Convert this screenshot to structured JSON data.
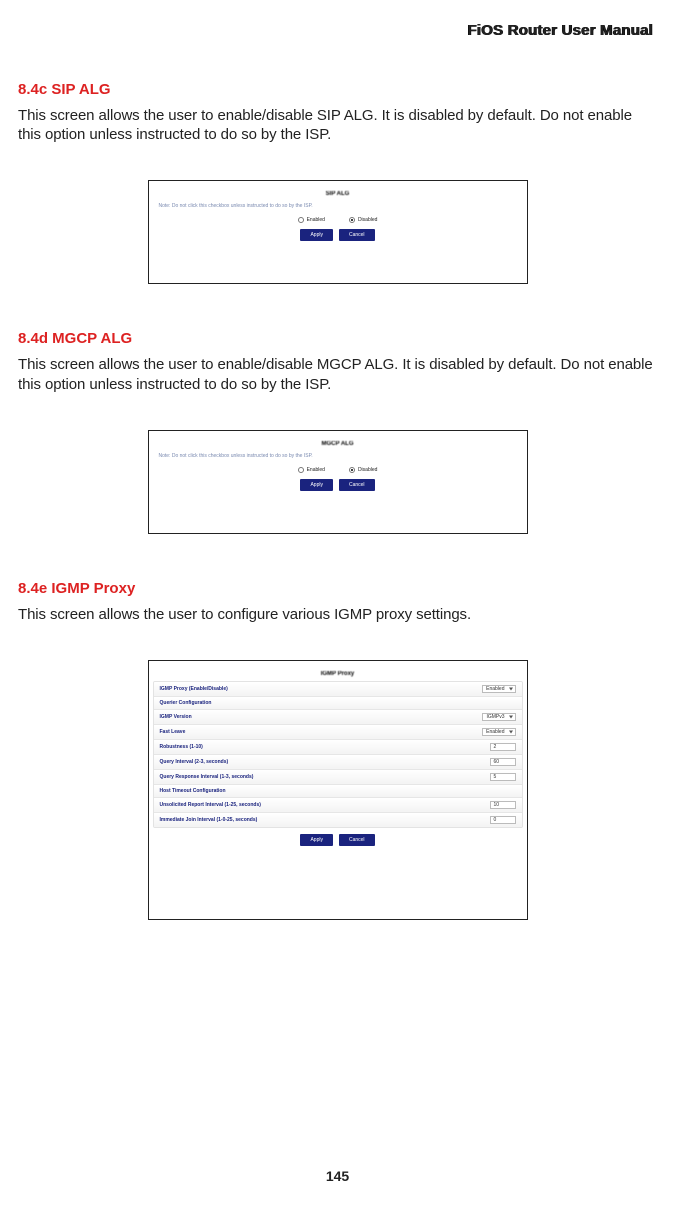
{
  "header": {
    "brand": "FiOS Router User Manual"
  },
  "sections": {
    "sip": {
      "heading": "8.4c  SIP ALG",
      "body": "This screen allows the user to enable/disable SIP ALG. It is disabled by default. Do not enable this option unless instructed to do so by the ISP."
    },
    "mgcp": {
      "heading": "8.4d  MGCP ALG",
      "body": "This screen allows the user to enable/disable MGCP ALG. It is disabled by default. Do not enable this option unless instructed to do so by the ISP."
    },
    "igmp": {
      "heading": "8.4e  IGMP Proxy",
      "body": "This screen allows the user to configure various IGMP proxy settings."
    }
  },
  "panels": {
    "sip": {
      "title": "SIP ALG",
      "note": "Note: Do not click this checkbox unless instructed to do so by the ISP.",
      "radio_enabled": "Enabled",
      "radio_disabled": "Disabled",
      "apply": "Apply",
      "cancel": "Cancel"
    },
    "mgcp": {
      "title": "MGCP ALG",
      "note": "Note: Do not click this checkbox unless instructed to do so by the ISP.",
      "radio_enabled": "Enabled",
      "radio_disabled": "Disabled",
      "apply": "Apply",
      "cancel": "Cancel"
    },
    "igmp_panel": {
      "title": "IGMP Proxy",
      "rows": [
        {
          "label": "IGMP Proxy (Enable/Disable)",
          "value": "Enabled",
          "control": "select"
        },
        {
          "label": "Querier Configuration",
          "value": "",
          "control": "none"
        },
        {
          "label": "IGMP Version",
          "value": "IGMPv3",
          "control": "select"
        },
        {
          "label": "Fast Leave",
          "value": "Enabled",
          "control": "select"
        },
        {
          "label": "Robustness (1-10)",
          "value": "2",
          "control": "input"
        },
        {
          "label": "Query Interval (2-3, seconds)",
          "value": "60",
          "control": "input"
        },
        {
          "label": "Query Response Interval (1-3, seconds)",
          "value": "5",
          "control": "input"
        },
        {
          "label": "Host Timeout Configuration",
          "value": "",
          "control": "none"
        },
        {
          "label": "Unsolicited Report Interval (1-25, seconds)",
          "value": "10",
          "control": "input"
        },
        {
          "label": "Immediate Join Interval (1-0-25, seconds)",
          "value": "0",
          "control": "input"
        }
      ],
      "apply": "Apply",
      "cancel": "Cancel"
    }
  },
  "page_number": "145"
}
